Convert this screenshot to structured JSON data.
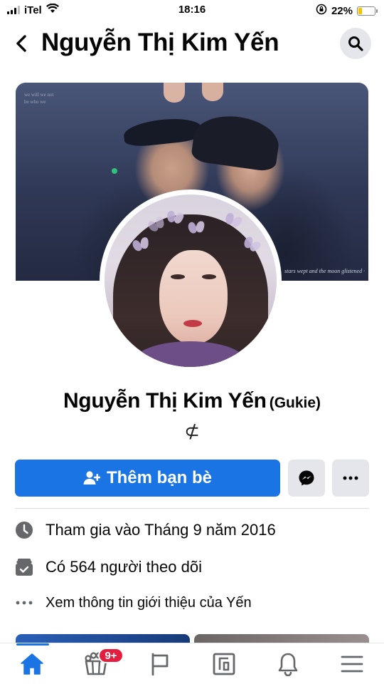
{
  "status_bar": {
    "carrier": "iTel",
    "time": "18:16",
    "battery_percent": "22%",
    "battery_level": 0.22,
    "icons": [
      "signal-icon",
      "wifi-icon",
      "orientation-lock-icon",
      "battery-icon"
    ]
  },
  "header": {
    "title": "Nguyễn Thị Kim Yến",
    "back_icon": "chevron-left-icon",
    "search_icon": "search-icon"
  },
  "cover": {
    "caption_top": "we will we not be who we",
    "caption_bottom": "stars wept and the moon glistened ·"
  },
  "profile": {
    "name": "Nguyễn Thị Kim Yến",
    "alternate_name": "(Gukie)",
    "bio": "⊄"
  },
  "actions": {
    "add_friend_label": "Thêm bạn bè",
    "add_friend_icon": "add-friend-icon",
    "messenger_icon": "messenger-icon",
    "more_icon": "more-horizontal-icon"
  },
  "intro": {
    "joined": "Tham gia vào Tháng 9 năm 2016",
    "followers": "Có 564 người theo dõi",
    "see_about": "Xem thông tin giới thiệu của Yến"
  },
  "tab_bar": {
    "active_tab": "home",
    "tabs": [
      "home",
      "watch",
      "pages",
      "marketplace",
      "notifications",
      "menu"
    ],
    "watch_badge": "9+"
  },
  "colors": {
    "accent": "#1b74e4",
    "badge": "#e41e3f",
    "secondary_button": "#e4e6eb"
  }
}
